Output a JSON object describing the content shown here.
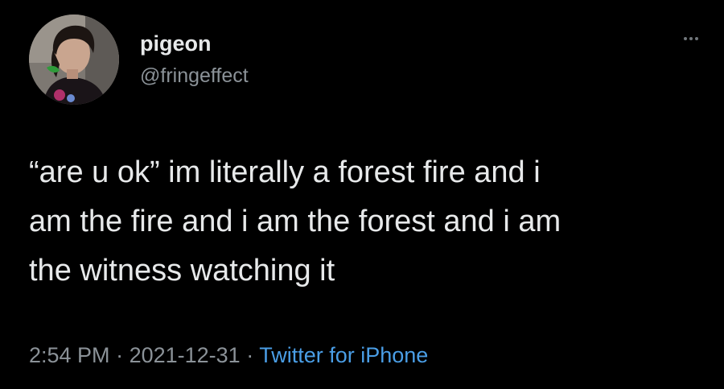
{
  "tweet": {
    "author": {
      "display_name": "pigeon",
      "handle": "@fringeffect",
      "avatar_icon": "profile-photo"
    },
    "more_icon": "more-horizontal-icon",
    "text_lines": [
      "“are u ok” im literally a forest fire and i",
      "am the fire and i am the forest and i am",
      "the witness watching it"
    ],
    "meta": {
      "time": "2:54 PM",
      "separator": " · ",
      "date": "2021-12-31",
      "source": "Twitter for iPhone"
    }
  },
  "colors": {
    "background": "#000000",
    "primary_text": "#e7e9ea",
    "secondary_text": "#8b9298",
    "link": "#4a9ee6"
  }
}
